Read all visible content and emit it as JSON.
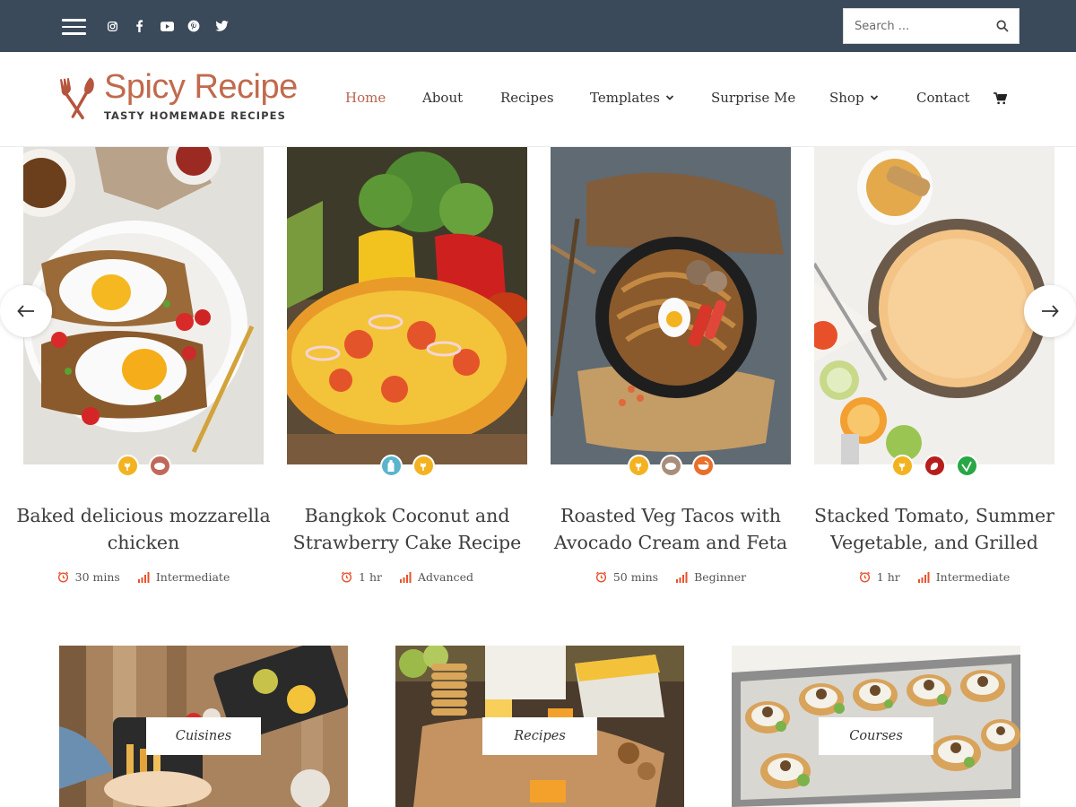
{
  "topbar": {
    "social": [
      "instagram-icon",
      "facebook-icon",
      "youtube-icon",
      "pinterest-icon",
      "twitter-icon"
    ],
    "search_placeholder": "Search ...",
    "bg_color": "#3a4a5a"
  },
  "header": {
    "logo_title": "Spicy Recipe",
    "logo_tagline": "TASTY HOMEMADE RECIPES",
    "nav": [
      {
        "label": "Home",
        "active": true
      },
      {
        "label": "About"
      },
      {
        "label": "Recipes"
      },
      {
        "label": "Templates",
        "dropdown": true
      },
      {
        "label": "Surprise Me"
      },
      {
        "label": "Shop",
        "dropdown": true
      },
      {
        "label": "Contact"
      }
    ],
    "accent_color": "#c06a4e"
  },
  "recipes": [
    {
      "title": "Baked delicious mozzarella chicken",
      "time": "30 mins",
      "difficulty": "Intermediate",
      "badges": [
        "gluten-free-icon",
        "meat-icon"
      ]
    },
    {
      "title": "Bangkok Coconut and Strawberry Cake Recipe",
      "time": "1 hr",
      "difficulty": "Advanced",
      "badges": [
        "dairy-free-icon",
        "gluten-free-icon"
      ]
    },
    {
      "title": "Roasted Veg Tacos with Avocado Cream and Feta",
      "time": "50 mins",
      "difficulty": "Beginner",
      "badges": [
        "gluten-free-icon",
        "meat-icon",
        "bowl-icon"
      ]
    },
    {
      "title": "Stacked Tomato, Summer Vegetable, and Grilled",
      "time": "1 hr",
      "difficulty": "Intermediate",
      "badges": [
        "gluten-free-icon",
        "nut-free-icon",
        "vegan-icon"
      ]
    }
  ],
  "categories": [
    {
      "label": "Cuisines"
    },
    {
      "label": "Recipes"
    },
    {
      "label": "Courses"
    }
  ]
}
